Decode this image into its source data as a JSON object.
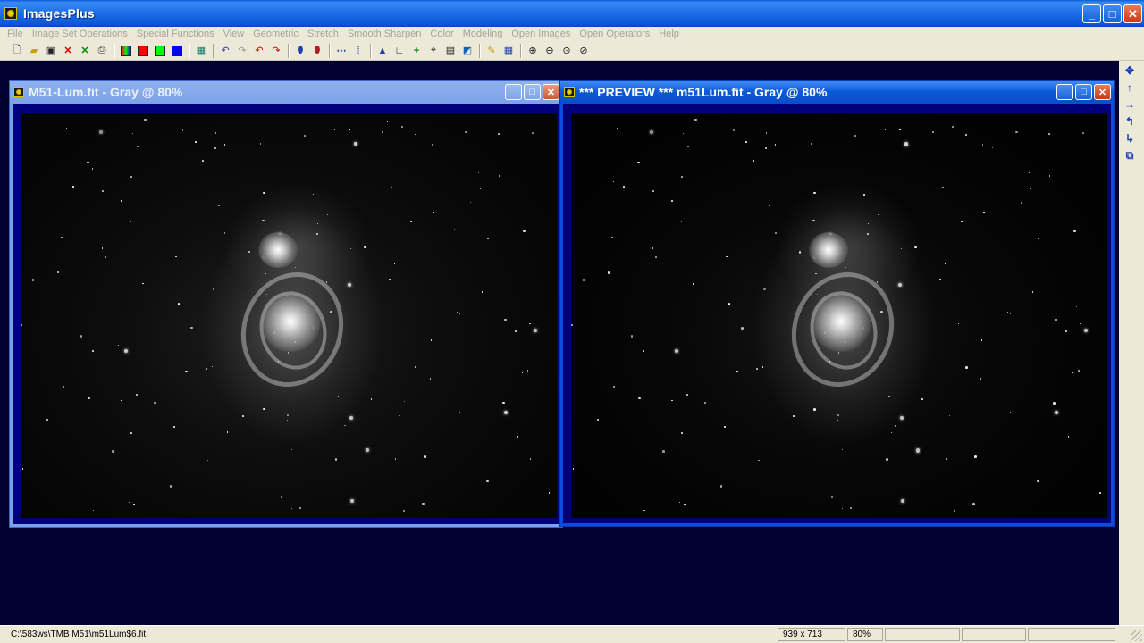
{
  "app": {
    "title": "ImagesPlus",
    "icon": "imagesplus-app-icon"
  },
  "window_controls": {
    "minimize": "_",
    "maximize": "□",
    "close": "✕"
  },
  "menu": [
    "File",
    "Image Set Operations",
    "Special Functions",
    "View",
    "Geometric",
    "Stretch",
    "Smooth Sharpen",
    "Color",
    "Modeling",
    "Open Images",
    "Open Operators",
    "Help"
  ],
  "toolbar": {
    "icons": [
      "new-file-icon",
      "open-folder-icon",
      "save-icon",
      "delete-red-x-icon",
      "close-green-x-icon",
      "print-icon",
      "rgb-channels-icon",
      "red-channel-icon",
      "green-channel-icon",
      "blue-channel-icon",
      "grid-icon",
      "undo-icon",
      "redo-icon",
      "undo-red-icon",
      "redo-red-icon",
      "blue-dot-icon",
      "red-dot-icon",
      "dotted-line-icon",
      "points-icon",
      "histogram-icon",
      "axes-icon",
      "crosshair-plus-icon",
      "target-icon",
      "image-edit-icon",
      "pencil-icon",
      "table-grid-icon",
      "zoom-in-icon",
      "zoom-out-icon",
      "zoom-fit-icon",
      "zoom-reset-icon"
    ]
  },
  "right_tools": [
    "move-arrows-icon",
    "arrow-up-icon",
    "arrow-right-icon",
    "rotate-left-icon",
    "rotate-right-icon",
    "copy-box-icon"
  ],
  "windows": [
    {
      "title": "M51-Lum.fit - Gray @ 80%",
      "state": "inactive"
    },
    {
      "title": "*** PREVIEW *** m51Lum.fit - Gray @ 80%",
      "state": "active"
    }
  ],
  "status": {
    "path": "C:\\583ws\\TMB M51\\m51Lum$6.fit",
    "dimensions": "939 x 713",
    "zoom": "80%",
    "cell3": "",
    "cell4": "",
    "cell5": ""
  },
  "colors": {
    "mdi_background": "#000033",
    "titlebar_blue": "#0b58d6",
    "menu_disabled_text": "#a7a395"
  }
}
